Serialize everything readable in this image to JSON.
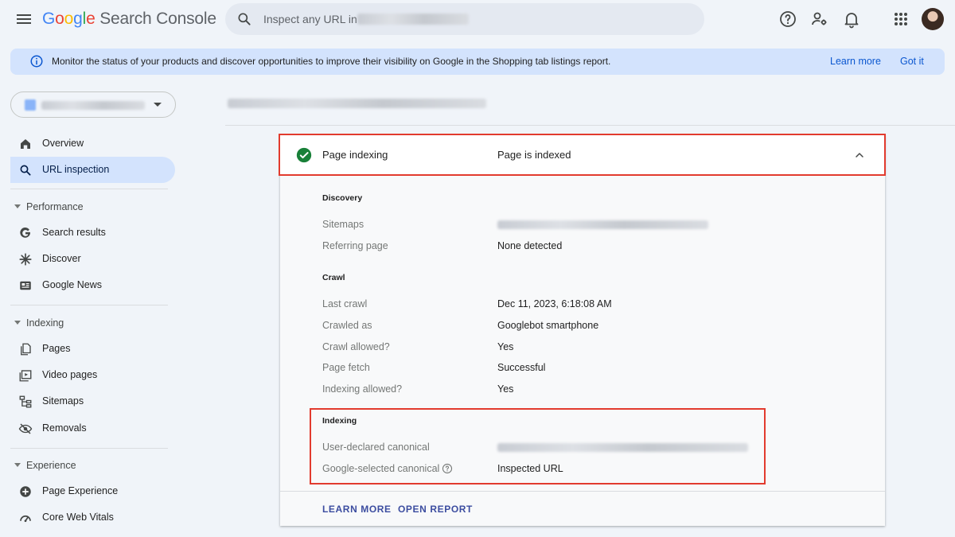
{
  "header": {
    "logo_google": [
      "G",
      "o",
      "o",
      "g",
      "l",
      "e"
    ],
    "logo_product": "Search Console",
    "search_placeholder": "Inspect any URL in",
    "icons": [
      "menu-icon",
      "search-icon",
      "help-icon",
      "manage-users-icon",
      "notifications-icon",
      "apps-icon",
      "avatar"
    ]
  },
  "banner": {
    "text": "Monitor the status of your products and discover opportunities to improve their visibility on Google in the Shopping tab listings report.",
    "learn_more": "Learn more",
    "got_it": "Got it"
  },
  "sidebar": {
    "items": [
      {
        "label": "Overview",
        "icon": "home-icon"
      },
      {
        "label": "URL inspection",
        "icon": "search-icon",
        "active": true
      }
    ],
    "sections": [
      {
        "title": "Performance",
        "items": [
          {
            "label": "Search results",
            "icon": "google-g-icon"
          },
          {
            "label": "Discover",
            "icon": "asterisk-icon"
          },
          {
            "label": "Google News",
            "icon": "news-icon"
          }
        ]
      },
      {
        "title": "Indexing",
        "items": [
          {
            "label": "Pages",
            "icon": "pages-icon"
          },
          {
            "label": "Video pages",
            "icon": "video-icon"
          },
          {
            "label": "Sitemaps",
            "icon": "sitemap-icon"
          },
          {
            "label": "Removals",
            "icon": "eye-off-icon"
          }
        ]
      },
      {
        "title": "Experience",
        "items": [
          {
            "label": "Page Experience",
            "icon": "plus-circle-icon"
          },
          {
            "label": "Core Web Vitals",
            "icon": "speed-icon"
          }
        ]
      }
    ]
  },
  "card": {
    "title": "Page indexing",
    "status": "Page is indexed",
    "discovery": {
      "title": "Discovery",
      "rows": [
        {
          "label": "Sitemaps",
          "value": ""
        },
        {
          "label": "Referring page",
          "value": "None detected"
        }
      ]
    },
    "crawl": {
      "title": "Crawl",
      "rows": [
        {
          "label": "Last crawl",
          "value": "Dec 11, 2023, 6:18:08 AM"
        },
        {
          "label": "Crawled as",
          "value": "Googlebot smartphone"
        },
        {
          "label": "Crawl allowed?",
          "value": "Yes"
        },
        {
          "label": "Page fetch",
          "value": "Successful"
        },
        {
          "label": "Indexing allowed?",
          "value": "Yes"
        }
      ]
    },
    "indexing": {
      "title": "Indexing",
      "rows": [
        {
          "label": "User-declared canonical",
          "value": ""
        },
        {
          "label": "Google-selected canonical",
          "value": "Inspected URL"
        }
      ]
    },
    "footer": {
      "learn_more": "LEARN MORE",
      "open_report": "OPEN REPORT"
    }
  },
  "colors": {
    "accent": "#0b57d0",
    "banner_bg": "#d3e3fd",
    "success": "#188038",
    "highlight": "#e23b2e"
  }
}
